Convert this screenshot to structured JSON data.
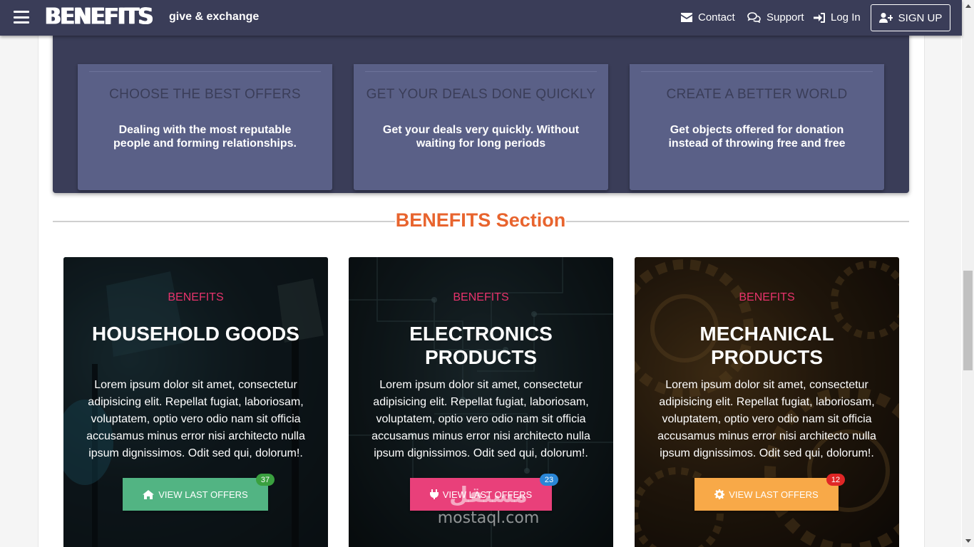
{
  "navbar": {
    "brand": "BENEFITS",
    "tagline": "give & exchange",
    "links": [
      {
        "label": "Contact",
        "icon": "envelope-icon"
      },
      {
        "label": "Support",
        "icon": "comments-icon"
      },
      {
        "label": "Log In",
        "icon": "sign-in-icon"
      }
    ],
    "signup_label": "SIGN UP"
  },
  "features": [
    {
      "title": "CHOOSE THE BEST OFFERS",
      "text": "Dealing with the most reputable people and forming relationships."
    },
    {
      "title": "GET YOUR DEALS DONE QUICKLY",
      "text": "Get your deals very quickly. Without waiting for long periods"
    },
    {
      "title": "CREATE A BETTER WORLD",
      "text": "Get objects offered for donation instead of throwing free and free"
    }
  ],
  "section": {
    "title": "BENEFITS Section"
  },
  "cards": [
    {
      "kicker": "BENEFITS",
      "title": "HOUSEHOLD GOODS",
      "text": "Lorem ipsum dolor sit amet, consectetur adipisicing elit. Repellat fugiat, laboriosam, voluptatem, optio vero odio nam sit officia accusamus minus error nisi architecto nulla ipsum dignissimos. Odit sed qui, dolorum!.",
      "button_label": "VIEW LAST OFFERS",
      "button_icon": "home-icon",
      "button_color": "#52b483",
      "badge": "37",
      "badge_color": "#3aa03f"
    },
    {
      "kicker": "BENEFITS",
      "title": "ELECTRONICS PRODUCTS",
      "text": "Lorem ipsum dolor sit amet, consectetur adipisicing elit. Repellat fugiat, laboriosam, voluptatem, optio vero odio nam sit officia accusamus minus error nisi architecto nulla ipsum dignissimos. Odit sed qui, dolorum!.",
      "button_label": "VIEW LAST OFFERS",
      "button_icon": "plug-icon",
      "button_color": "#e9407a",
      "badge": "23",
      "badge_color": "#2a86d6"
    },
    {
      "kicker": "BENEFITS",
      "title": "MECHANICAL PRODUCTS",
      "text": "Lorem ipsum dolor sit amet, consectetur adipisicing elit. Repellat fugiat, laboriosam, voluptatem, optio vero odio nam sit officia accusamus minus error nisi architecto nulla ipsum dignissimos. Odit sed qui, dolorum!.",
      "button_label": "VIEW LAST OFFERS",
      "button_icon": "cog-icon",
      "button_color": "#f8a948",
      "badge": "12",
      "badge_color": "#e02626"
    }
  ],
  "watermark": {
    "arabic": "مستقل",
    "latin": "mostaql.com"
  },
  "colors": {
    "navbar": "#3a3d58",
    "feature_card": "#5a6087",
    "section_title": "#e8642e",
    "kicker": "#e8336c"
  }
}
